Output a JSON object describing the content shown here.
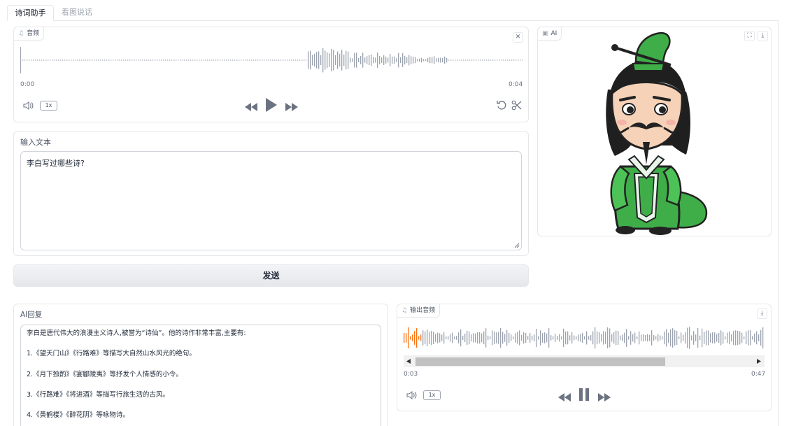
{
  "tabs": [
    {
      "label": "诗词助手",
      "active": true
    },
    {
      "label": "看图说话",
      "active": false
    }
  ],
  "audio_input": {
    "label": "音频",
    "icon": "music-note-icon",
    "time_start": "0:00",
    "time_end": "0:04",
    "rate": "1x"
  },
  "text_input": {
    "label": "输入文本",
    "value": "李白写过哪些诗?"
  },
  "send_button": {
    "label": "发送"
  },
  "image_panel": {
    "label": "AI",
    "icon": "image-icon"
  },
  "reply": {
    "label": "AI回复",
    "lines": [
      "李白是唐代伟大的浪漫主义诗人,被誉为“诗仙”。他的诗作非常丰富,主要有:",
      "1.《望天门山》《行路难》等描写大自然山水风光的绝句。",
      "2.《月下独酌》《宴郿陵夷》等抒发个人情感的小令。",
      "3.《行路难》《将进酒》等描写行旅生活的古风。",
      "4.《黄鹤楼》《醉花阴》等咏物诗。"
    ]
  },
  "audio_output": {
    "label": "输出音频",
    "icon": "music-note-icon",
    "time_current": "0:03",
    "time_end": "0:47",
    "rate": "1x",
    "progress_fraction": 0.064,
    "scroll_view_fraction": 0.74
  },
  "colors": {
    "accent_orange": "#f97316",
    "waveform_gray": "#9ca3af",
    "character_green": "#3fae49"
  }
}
